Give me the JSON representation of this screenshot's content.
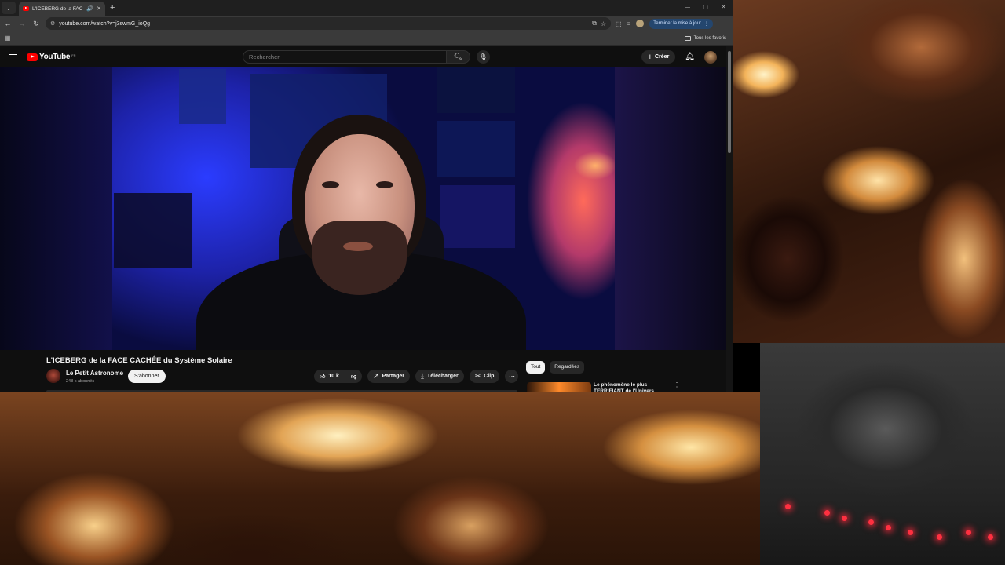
{
  "browser": {
    "tab_title": "L'ICEBERG de la FACE CACHÉ",
    "url": "youtube.com/watch?v=j3swmG_ioQg",
    "update_button": "Terminer la mise à jour",
    "bookmarks_all": "Tous les favoris"
  },
  "youtube": {
    "logo_text": "YouTube",
    "logo_country": "FR",
    "search_placeholder": "Rechercher",
    "create_label": "Créer",
    "video": {
      "title": "L'ICEBERG de la FACE CACHÉE du Système Solaire",
      "channel": "Le Petit Astronome",
      "subscribers": "248 k abonnés",
      "subscribe": "S'abonner",
      "likes": "10 k",
      "share": "Partager",
      "download": "Télécharger",
      "clip": "Clip"
    },
    "chips": [
      "Tout",
      "Regardées"
    ],
    "recommendation": {
      "title": "Le phénomène le plus TERRIFIANT de l'Univers"
    }
  },
  "icons": {
    "hamburger": "menu-icon",
    "search": "search-icon",
    "mic": "mic-icon",
    "bell": "bell-icon",
    "like": "thumb-up-icon",
    "dislike": "thumb-down-icon",
    "share": "share-icon",
    "download": "download-icon",
    "clip": "scissors-icon"
  },
  "colors": {
    "yt_red": "#ff0000",
    "page_bg": "#0f0f0f",
    "update_btn": "#24466e"
  }
}
